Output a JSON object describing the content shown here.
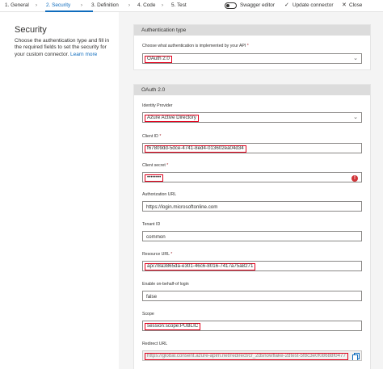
{
  "nav": {
    "steps": [
      {
        "label": "1. General"
      },
      {
        "label": "2. Security"
      },
      {
        "label": "3. Definition"
      },
      {
        "label": "4. Code"
      },
      {
        "label": "5. Test"
      }
    ],
    "swagger_label": "Swagger editor",
    "update_label": "Update connector",
    "close_label": "Close",
    "active_step": "2. Security"
  },
  "left": {
    "title": "Security",
    "description": "Choose the authentication type and fill in the required fields to set the security for your custom connector.",
    "learn_more": "Learn more"
  },
  "auth_card": {
    "header": "Authentication type",
    "label": "Choose what authentication is implemented by your API",
    "required_mark": "*",
    "value": "OAuth 2.0"
  },
  "oauth_card": {
    "header": "OAuth 2.0",
    "fields": {
      "identity_provider": {
        "label": "Identity Provider",
        "value": "Azure Active Directory"
      },
      "client_id": {
        "label": "Client ID",
        "required_mark": "*",
        "value": "f67809dd-5dce-4741-8ed4-013602ea04d34"
      },
      "client_secret": {
        "label": "Client secret",
        "required_mark": "*",
        "value": "••••••••"
      },
      "authorization_url": {
        "label": "Authorization URL",
        "value": "https://login.microsoftonline.com"
      },
      "tenant_id": {
        "label": "Tenant ID",
        "value": "common"
      },
      "resource_url": {
        "label": "Resource URL",
        "required_mark": "*",
        "value": "api://8a3865da-e301-46c6-8016-7417a75a8271"
      },
      "on_behalf_of": {
        "label": "Enable on-behalf-of login",
        "value": "false"
      },
      "scope": {
        "label": "Scope",
        "value": "session:scope:PUBLIC"
      },
      "redirect_url": {
        "label": "Redirect URL",
        "value": "https://global.consent.azure-apim.net/redirect/cr_2dsnowflake-2dtest-5f8c3e0f08688f0477"
      }
    }
  },
  "colors": {
    "accent": "#0f6cbd",
    "highlight": "#e0001b",
    "error": "#d13438"
  }
}
